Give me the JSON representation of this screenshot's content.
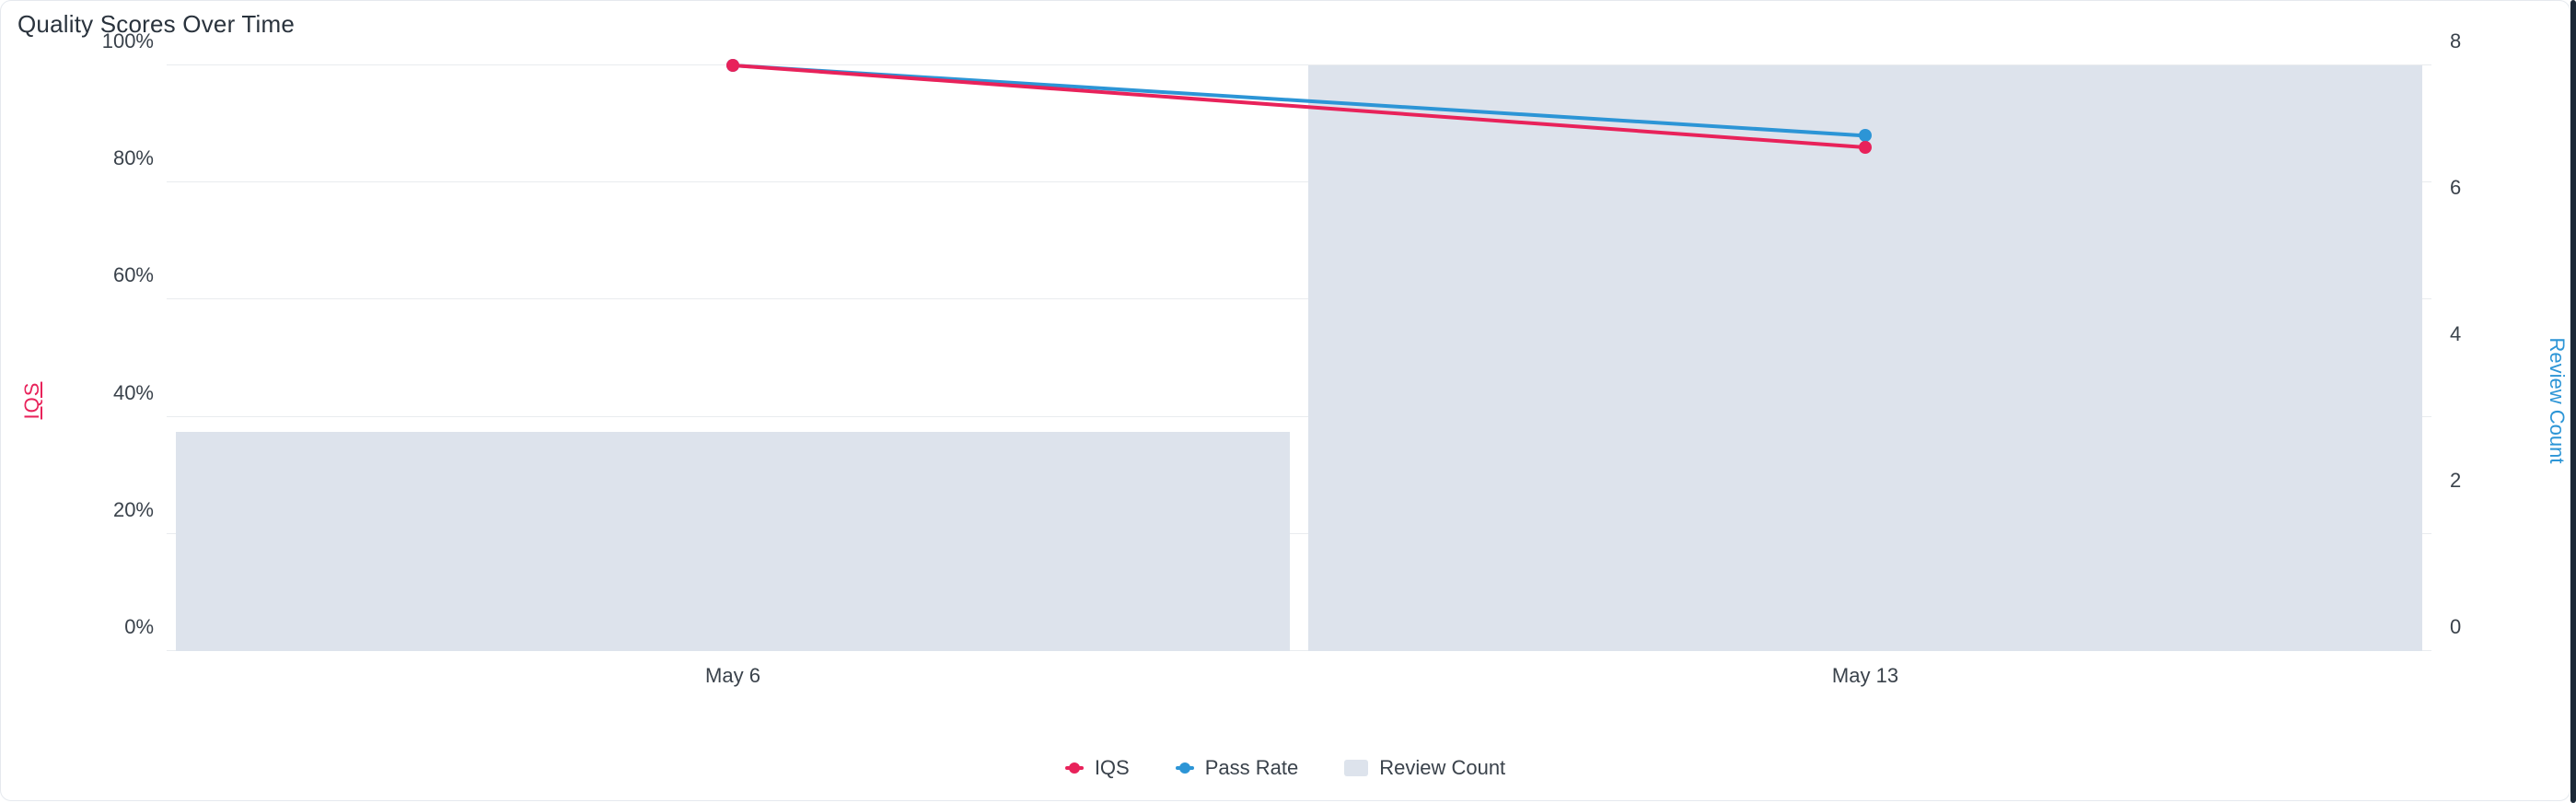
{
  "title": "Quality Scores Over Time",
  "y_left_title": "IQS",
  "y_right_title": "Review Count",
  "y_left_ticks": [
    "0%",
    "20%",
    "40%",
    "60%",
    "80%",
    "100%"
  ],
  "y_right_ticks": [
    "0",
    "2",
    "4",
    "6",
    "8"
  ],
  "x_categories": [
    "May 6",
    "May 13"
  ],
  "legend": {
    "iqs": "IQS",
    "pass": "Pass Rate",
    "count": "Review Count"
  },
  "chart_data": {
    "type": "bar",
    "title": "Quality Scores Over Time",
    "categories": [
      "May 6",
      "May 13"
    ],
    "series": [
      {
        "name": "IQS",
        "axis": "left",
        "type": "line",
        "values": [
          100,
          86
        ]
      },
      {
        "name": "Pass Rate",
        "axis": "left",
        "type": "line",
        "values": [
          100,
          88
        ]
      },
      {
        "name": "Review Count",
        "axis": "right",
        "type": "bar",
        "values": [
          3,
          8
        ]
      }
    ],
    "y_left": {
      "label": "IQS",
      "unit": "%",
      "lim": [
        0,
        100
      ],
      "ticks": [
        0,
        20,
        40,
        60,
        80,
        100
      ]
    },
    "y_right": {
      "label": "Review Count",
      "lim": [
        0,
        8
      ],
      "ticks": [
        0,
        2,
        4,
        6,
        8
      ]
    },
    "xlabel": "",
    "grid": true,
    "legend_position": "bottom",
    "colors": {
      "IQS": "#e8225a",
      "Pass Rate": "#2c95d6",
      "Review Count": "#dde3ec"
    }
  }
}
